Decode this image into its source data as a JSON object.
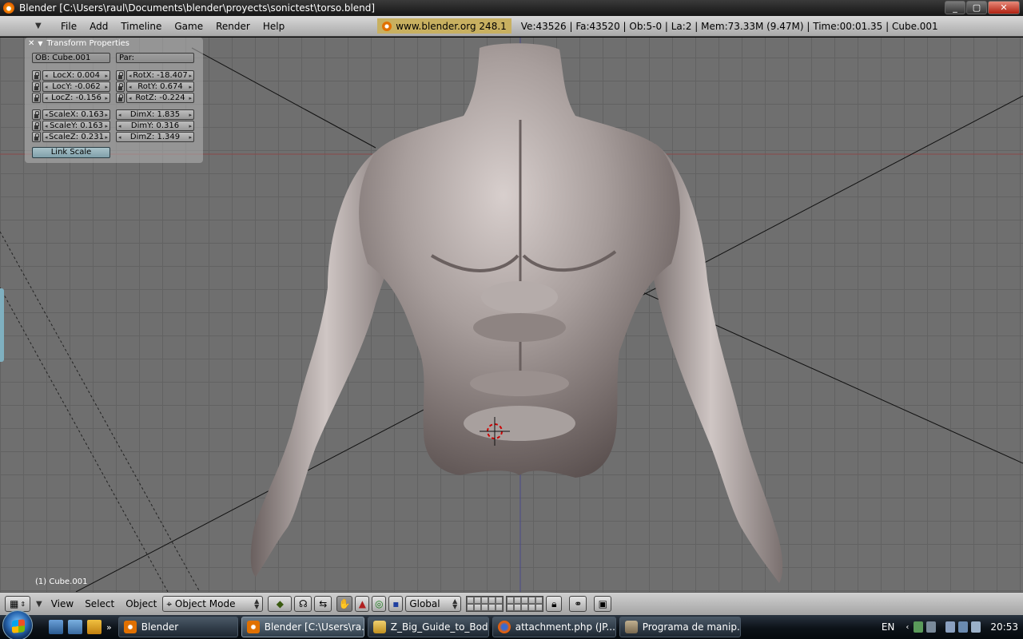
{
  "window": {
    "title": "Blender [C:\\Users\\raul\\Documents\\blender\\proyects\\sonictest\\torso.blend]",
    "minimize": "_",
    "maximize": "▢",
    "close": "✕"
  },
  "info_header": {
    "menus": [
      "File",
      "Add",
      "Timeline",
      "Game",
      "Render",
      "Help"
    ],
    "version": "www.blender.org 248.1",
    "stats": "Ve:43526 | Fa:43520 | Ob:5-0 | La:2  | Mem:73.33M (9.47M)  | Time:00:01.35 | Cube.001"
  },
  "transform_panel": {
    "title": "Transform Properties",
    "ob_field": "OB: Cube.001",
    "par_field": "Par:",
    "loc": [
      "LocX: 0.004",
      "LocY: -0.062",
      "LocZ: -0.156"
    ],
    "rot": [
      "RotX: -18.407",
      "RotY: 0.674",
      "RotZ: -0.224"
    ],
    "scale": [
      "ScaleX: 0.163",
      "ScaleY: 0.163",
      "ScaleZ: 0.231"
    ],
    "dim": [
      "DimX: 1.835",
      "DimY: 0.316",
      "DimZ: 1.349"
    ],
    "link_scale": "Link Scale"
  },
  "viewport": {
    "object_label": "(1) Cube.001"
  },
  "view_header": {
    "menus": [
      "View",
      "Select",
      "Object"
    ],
    "mode": "Object Mode",
    "orientation": "Global"
  },
  "taskbar": {
    "tasks": [
      {
        "label": "Blender",
        "active": false
      },
      {
        "label": "Blender [C:\\Users\\ra...",
        "active": true
      },
      {
        "label": "Z_Big_Guide_to_Bod...",
        "active": false
      },
      {
        "label": "attachment.php (JP...",
        "active": false
      },
      {
        "label": "Programa de manip...",
        "active": false
      }
    ],
    "language": "EN",
    "clock": "20:53"
  },
  "colors": {
    "viewport_bg": "#6f6f6f",
    "mesh": "#a89e9c",
    "header_bg": "#b8b8b8",
    "accent_orange": "#e07000"
  }
}
